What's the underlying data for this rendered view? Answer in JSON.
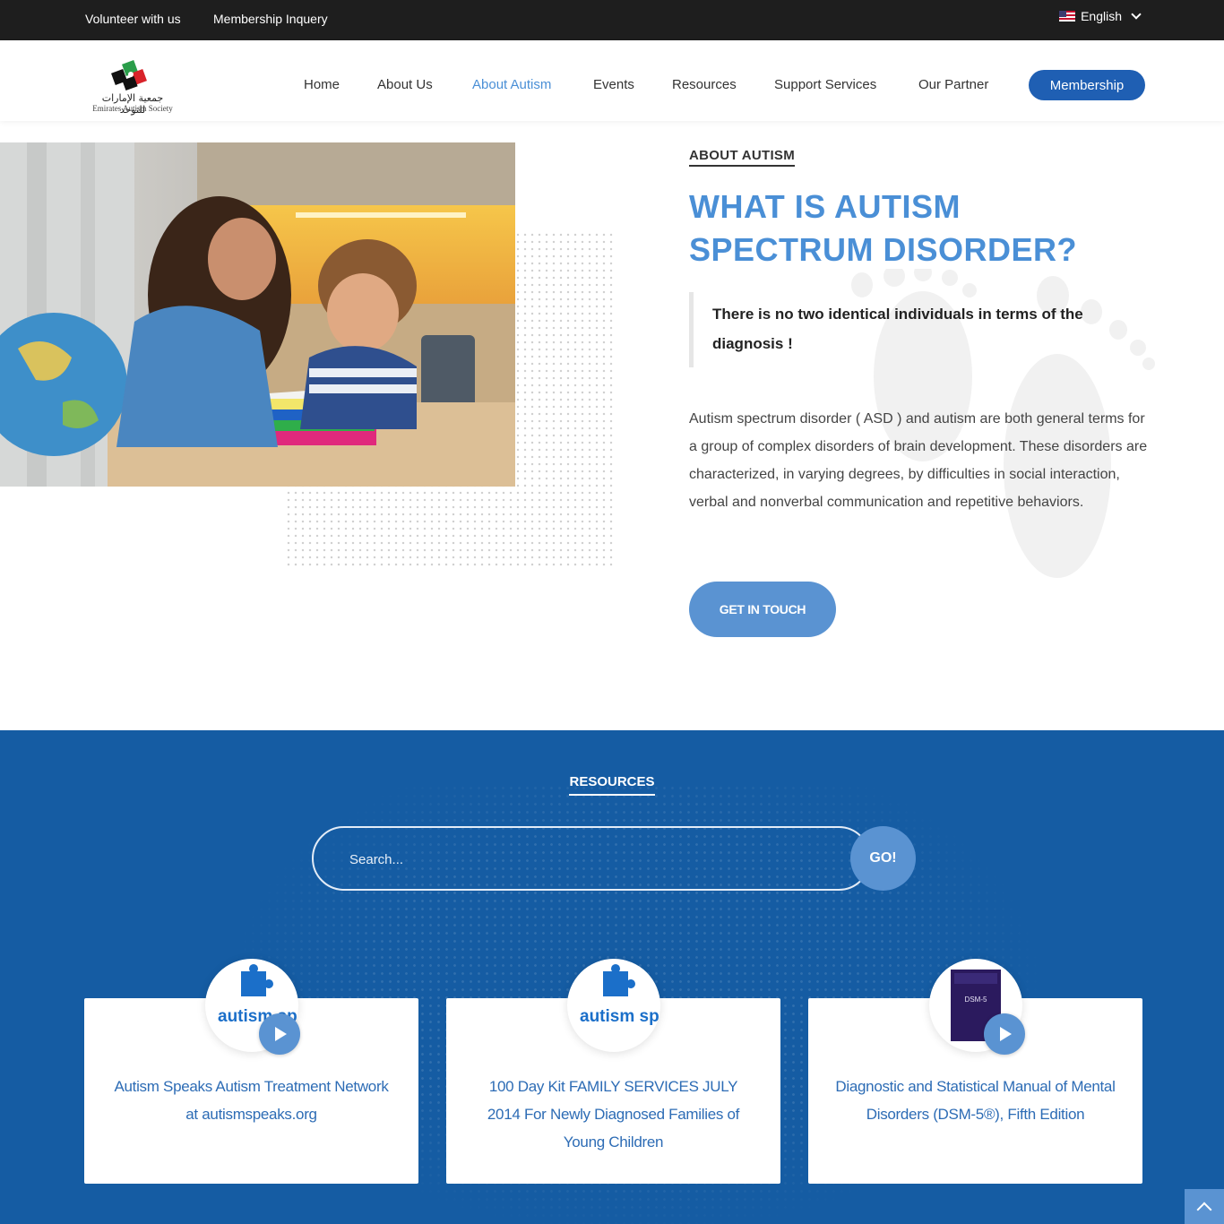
{
  "topbar": {
    "links": [
      "Volunteer with us",
      "Membership Inquery"
    ],
    "language": "English"
  },
  "logo": {
    "arabic": "جمعية الإمارات للتوحد",
    "english": "Emirates Autism Society"
  },
  "nav": {
    "items": [
      "Home",
      "About Us",
      "About Autism",
      "Events",
      "Resources",
      "Support Services",
      "Our Partner"
    ],
    "active": "About Autism",
    "membership": "Membership"
  },
  "about": {
    "eyebrow": "ABOUT AUTISM",
    "headline_line1": "WHAT IS AUTISM",
    "headline_line2": "SPECTRUM DISORDER?",
    "quote": "There is no two identical individuals in terms of the diagnosis !",
    "description": "Autism spectrum disorder ( ASD ) and autism are both general terms for a group of complex disorders of brain development. These disorders are characterized, in varying degrees, by difficulties in social interaction, verbal and nonverbal communication and repetitive behaviors.",
    "cta": "GET IN TOUCH"
  },
  "resources": {
    "title": "RESOURCES",
    "search_placeholder": "Search...",
    "go": "GO!",
    "cards": [
      {
        "logo": "autism speaks",
        "title": "Autism Speaks Autism Treatment Network at autismspeaks.org"
      },
      {
        "logo": "autism speaks",
        "title": "100 Day Kit FAMILY SERVICES JULY 2014 For Newly Diagnosed Families of Young Children"
      },
      {
        "logo": "DSM-5",
        "title": "Diagnostic and Statistical Manual of Mental Disorders (DSM-5®), Fifth Edition"
      }
    ]
  },
  "colors": {
    "accent": "#4a8fd6",
    "brand_dark": "#1f5fb3",
    "resources_bg": "#155ca3",
    "topbar_bg": "#1e1e1e"
  }
}
